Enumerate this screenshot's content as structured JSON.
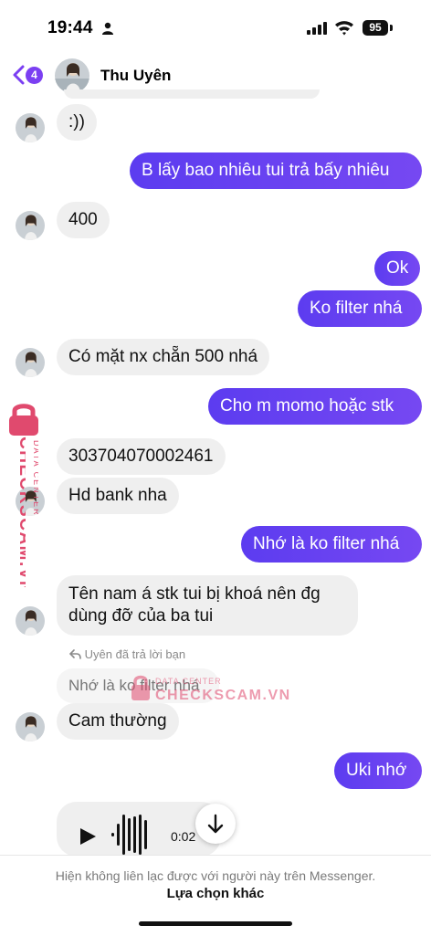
{
  "status_bar": {
    "time": "19:44",
    "battery": "95"
  },
  "header": {
    "back_badge": "4",
    "contact_name": "Thu Uyên"
  },
  "messages": [
    {
      "text": ":))"
    },
    {
      "text": "B lấy bao nhiêu tui trả bấy nhiêu"
    },
    {
      "text": "400"
    },
    {
      "text": "Ok"
    },
    {
      "text": "Ko filter nhá"
    },
    {
      "text": "Có mặt nx chẵn 500 nhá"
    },
    {
      "text": "Cho m momo hoặc stk"
    },
    {
      "text": "303704070002461"
    },
    {
      "text": "Hd bank nha"
    },
    {
      "text": "Nhớ là ko filter nhá"
    },
    {
      "text": "Tên nam á stk tui bị khoá nên đg",
      "text2": "dùng đỡ của ba tui"
    },
    {
      "text": "Cam thường"
    },
    {
      "text": "Uki nhớ"
    }
  ],
  "reply": {
    "note": "Uyên đã trả lời bạn",
    "quote": "Nhớ là ko filter nhá"
  },
  "voice_message": {
    "duration": "0:02"
  },
  "footer": {
    "info": "Hiện không liên lạc được với người này trên Messenger.",
    "action": "Lựa chọn khác"
  },
  "watermark": {
    "brand": "CHECKSCAM.VN",
    "subtitle": "DATA CENTER"
  },
  "colors": {
    "accent": "#7b3ff2",
    "outgoing_start": "#5c3cf0",
    "outgoing_end": "#7648f2",
    "incoming": "#efefef",
    "watermark": "#e04a6e"
  },
  "icons": [
    "person-icon",
    "signal-icon",
    "wifi-icon",
    "back-icon",
    "play-icon",
    "waveform-icon",
    "arrow-down-icon",
    "lock-icon",
    "reply-icon"
  ]
}
